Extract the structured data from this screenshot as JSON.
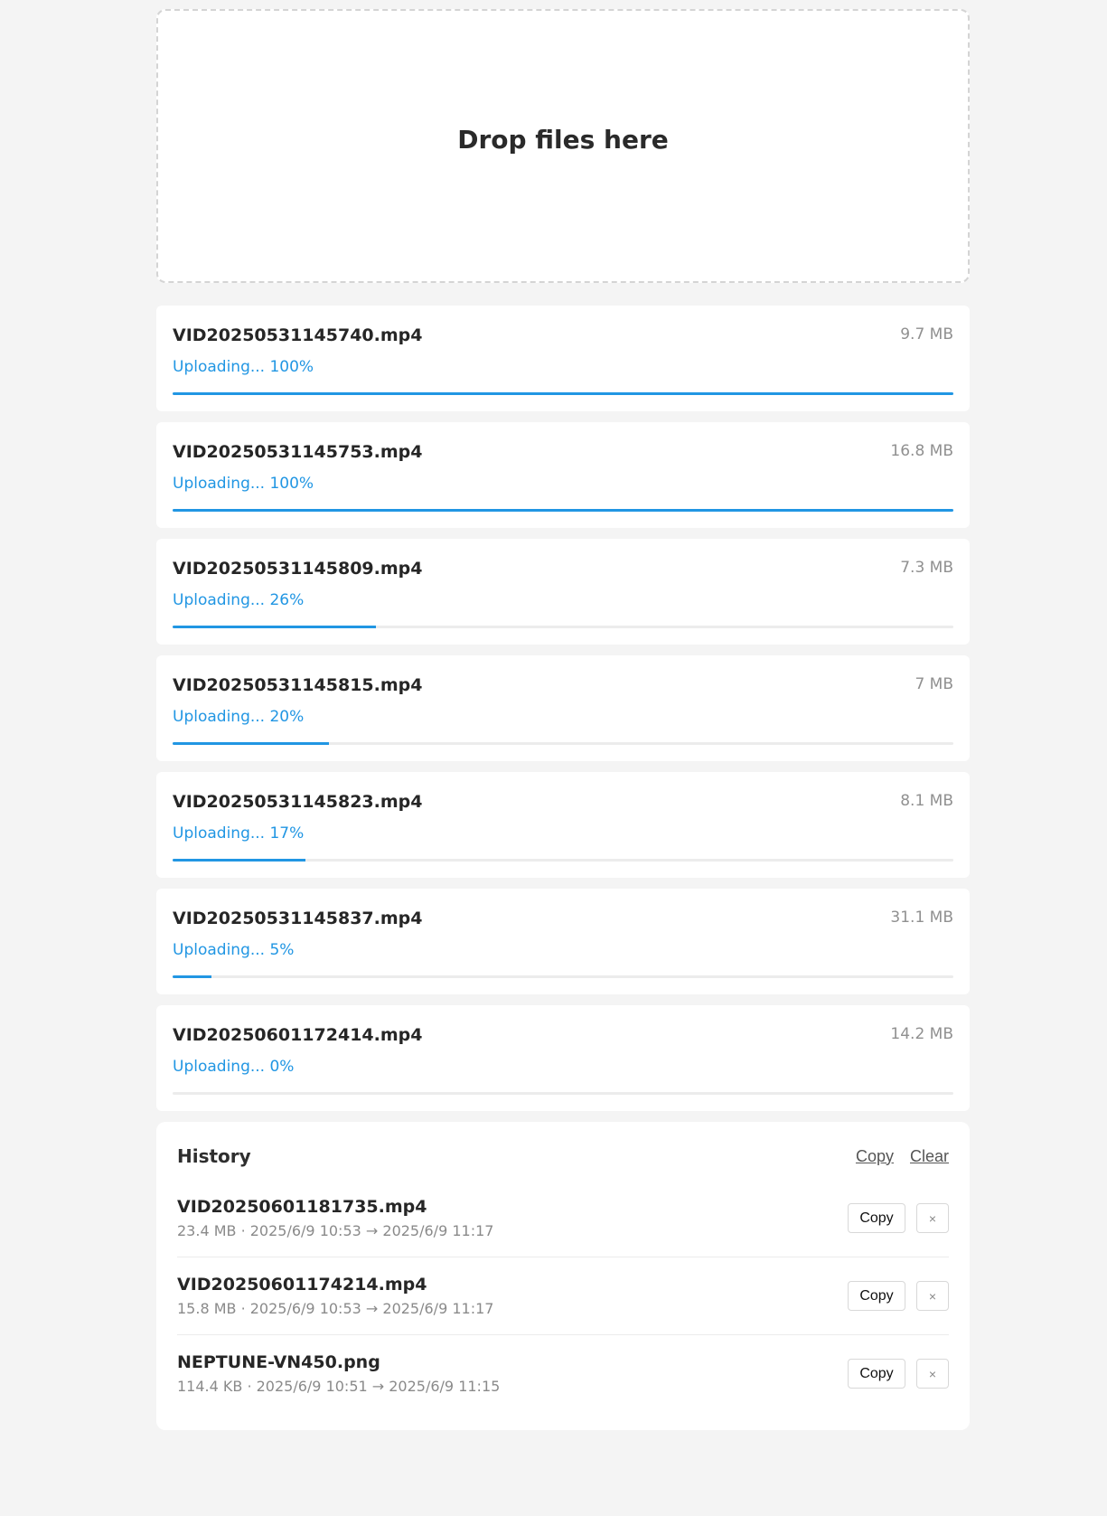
{
  "dropzone": {
    "title": "Drop files here"
  },
  "uploads": [
    {
      "name": "VID20250531145740.mp4",
      "size": "9.7 MB",
      "status": "Uploading... 100%",
      "progress": 100
    },
    {
      "name": "VID20250531145753.mp4",
      "size": "16.8 MB",
      "status": "Uploading... 100%",
      "progress": 100
    },
    {
      "name": "VID20250531145809.mp4",
      "size": "7.3 MB",
      "status": "Uploading... 26%",
      "progress": 26
    },
    {
      "name": "VID20250531145815.mp4",
      "size": "7 MB",
      "status": "Uploading... 20%",
      "progress": 20
    },
    {
      "name": "VID20250531145823.mp4",
      "size": "8.1 MB",
      "status": "Uploading... 17%",
      "progress": 17
    },
    {
      "name": "VID20250531145837.mp4",
      "size": "31.1 MB",
      "status": "Uploading... 5%",
      "progress": 5
    },
    {
      "name": "VID20250601172414.mp4",
      "size": "14.2 MB",
      "status": "Uploading... 0%",
      "progress": 0
    }
  ],
  "history": {
    "title": "History",
    "copy_label": "Copy",
    "clear_label": "Clear",
    "items": [
      {
        "name": "VID20250601181735.mp4",
        "meta": "23.4 MB · 2025/6/9 10:53 → 2025/6/9 11:17",
        "copy_label": "Copy",
        "remove_icon": "×"
      },
      {
        "name": "VID20250601174214.mp4",
        "meta": "15.8 MB · 2025/6/9 10:53 → 2025/6/9 11:17",
        "copy_label": "Copy",
        "remove_icon": "×"
      },
      {
        "name": "NEPTUNE-VN450.png",
        "meta": "114.4 KB · 2025/6/9 10:51 → 2025/6/9 11:15",
        "copy_label": "Copy",
        "remove_icon": "×"
      }
    ]
  },
  "colors": {
    "accent": "#2196e3",
    "background": "#f4f4f4"
  }
}
